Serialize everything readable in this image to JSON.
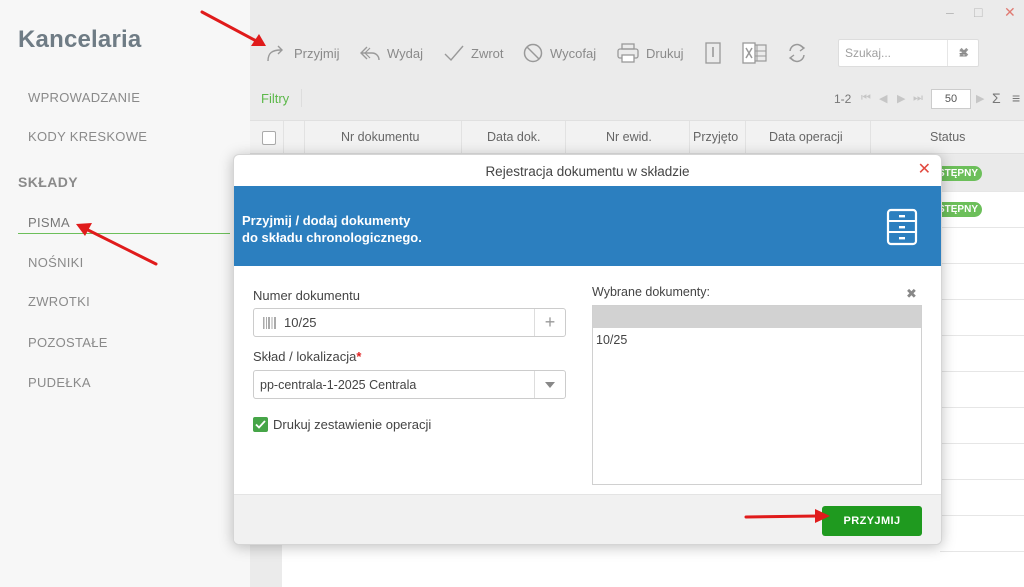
{
  "app": {
    "title": "Kancelaria"
  },
  "window_controls": {
    "minimize": "–",
    "maximize": "□",
    "close": "✕"
  },
  "sidebar": {
    "items": [
      {
        "label": "WPROWADZANIE"
      },
      {
        "label": "KODY KRESKOWE"
      }
    ],
    "section": "SKŁADY",
    "section_items": [
      {
        "label": "PISMA",
        "active": true
      },
      {
        "label": "NOŚNIKI"
      },
      {
        "label": "ZWROTKI"
      },
      {
        "label": "POZOSTAŁE"
      },
      {
        "label": "PUDEŁKA"
      }
    ]
  },
  "toolbar": {
    "receive": "Przyjmij",
    "issue": "Wydaj",
    "return": "Zwrot",
    "withdraw": "Wycofaj",
    "print": "Drukuj"
  },
  "search": {
    "placeholder": "Szukaj..."
  },
  "filters": {
    "label": "Filtry"
  },
  "pager": {
    "range": "1-2",
    "page_size": "50",
    "sum_symbol": "Σ"
  },
  "table": {
    "columns": [
      "Nr dokumentu",
      "Data dok.",
      "Nr ewid.",
      "Przyjęto",
      "Data operacji",
      "Status"
    ],
    "rows": [
      {
        "status": "STĘPNY"
      },
      {
        "status": "STĘPNY"
      }
    ]
  },
  "modal": {
    "title": "Rejestracja dokumentu w składzie",
    "close": "✕",
    "banner_line1": "Przyjmij / dodaj dokumenty",
    "banner_line2": "do składu chronologicznego.",
    "doc_number_label": "Numer dokumentu",
    "doc_number_value": "10/25",
    "location_label": "Skład / lokalizacja",
    "required_mark": "*",
    "location_value": "pp-centrala-1-2025 Centrala",
    "print_checkbox_label": "Drukuj zestawienie operacji",
    "print_checked": true,
    "selected_label": "Wybrane dokumenty:",
    "selected_clear": "✖",
    "selected_items": [
      "10/25"
    ],
    "accept_button": "PRZYJMIJ"
  },
  "colors": {
    "accent_blue": "#2c7fbf",
    "accept_green": "#1f9a1f",
    "status_green": "#6cbf5a",
    "close_red": "#e2493f",
    "arrow_red": "#e01b1b"
  },
  "icons": [
    "redo-arrow-icon",
    "reply-icon",
    "check-icon",
    "ban-icon",
    "printer-icon",
    "export-icon",
    "excel-icon",
    "refresh-icon",
    "barcode-icon",
    "plus-icon",
    "chevron-down-icon",
    "cabinet-icon",
    "menu-icon",
    "clear-icon"
  ]
}
